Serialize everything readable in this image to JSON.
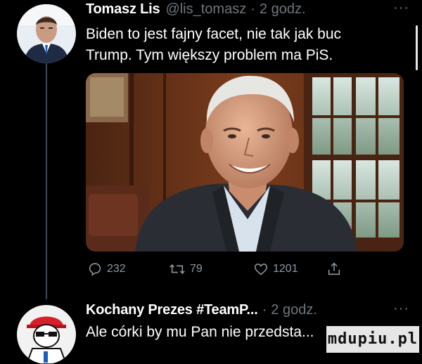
{
  "tweets": [
    {
      "display_name": "Tomasz Lis",
      "handle": "@lis_tomasz",
      "separator": "·",
      "time": "2 godz.",
      "more": "···",
      "text": "Biden to jest fajny facet, nie tak jak buc\nTrump. Tym większy  problem ma PiS.",
      "stats": {
        "replies": "232",
        "retweets": "79",
        "likes": "1201"
      },
      "icons": {
        "reply": "reply-icon",
        "retweet": "retweet-icon",
        "like": "heart-icon",
        "share": "share-icon"
      }
    },
    {
      "display_name": "Kochany Prezes #TeamP...",
      "separator": "·",
      "time": "2 godz.",
      "more": "···",
      "text": "Ale córki by mu Pan nie przedsta..."
    }
  ],
  "watermark": "mdupiu.pl",
  "colors": {
    "background": "#000000",
    "muted": "#6e767d",
    "icon": "#8b98a5",
    "thread_line": "#3d4a55"
  }
}
